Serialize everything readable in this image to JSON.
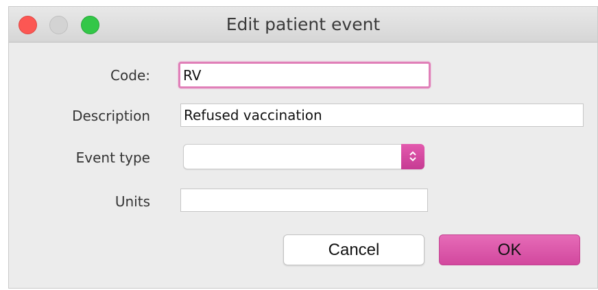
{
  "window": {
    "title": "Edit patient event"
  },
  "form": {
    "code": {
      "label": "Code:",
      "value": "RV"
    },
    "description": {
      "label": "Description",
      "value": "Refused vaccination"
    },
    "event_type": {
      "label": "Event type",
      "value": ""
    },
    "units": {
      "label": "Units",
      "value": ""
    }
  },
  "buttons": {
    "cancel_label": "Cancel",
    "ok_label": "OK"
  },
  "icons": {
    "close": "close-icon",
    "minimize": "minimize-icon",
    "maximize": "maximize-icon",
    "select_arrow": "chevron-up-down-icon"
  },
  "colors": {
    "accent": "#d94fa6",
    "focus_ring": "#e07fb8",
    "close": "#fc5753",
    "minimize": "#d3d3d3",
    "maximize": "#33c748"
  }
}
